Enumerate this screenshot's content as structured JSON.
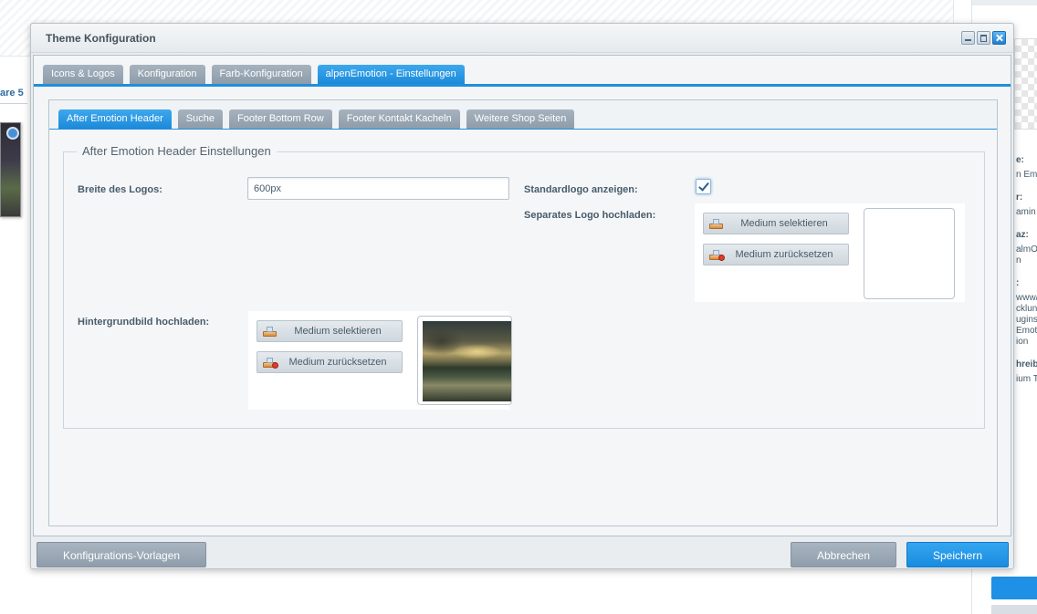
{
  "background": {
    "left_tab_label": "are 5",
    "right_panel_texts": [
      {
        "text": "e:",
        "bold": true
      },
      {
        "text": "n Emo",
        "bold": false
      },
      {
        "text": "r:",
        "bold": true
      },
      {
        "text": "amin I",
        "bold": false
      },
      {
        "text": "az:",
        "bold": true
      },
      {
        "text": "almO",
        "bold": false
      },
      {
        "text": "n",
        "bold": false
      },
      {
        "text": ":",
        "bold": true
      },
      {
        "text": "www/",
        "bold": false
      },
      {
        "text": "cklun",
        "bold": false
      },
      {
        "text": "ugins/",
        "bold": false
      },
      {
        "text": "Emoti",
        "bold": false
      },
      {
        "text": "ion",
        "bold": false
      },
      {
        "text": "hreib",
        "bold": true
      },
      {
        "text": "ium T",
        "bold": false
      }
    ]
  },
  "window": {
    "title": "Theme Konfiguration",
    "outer_tabs": [
      {
        "label": "Icons & Logos",
        "active": false
      },
      {
        "label": "Konfiguration",
        "active": false
      },
      {
        "label": "Farb-Konfiguration",
        "active": false
      },
      {
        "label": "alpenEmotion - Einstellungen",
        "active": true
      }
    ],
    "inner_tabs": [
      {
        "label": "After Emotion Header",
        "active": true
      },
      {
        "label": "Suche",
        "active": false
      },
      {
        "label": "Footer Bottom Row",
        "active": false
      },
      {
        "label": "Footer Kontakt Kacheln",
        "active": false
      },
      {
        "label": "Weitere Shop Seiten",
        "active": false
      }
    ],
    "fieldset": {
      "legend": "After Emotion Header Einstellungen",
      "logo_width_label": "Breite des Logos:",
      "logo_width_value": "600px",
      "standard_logo_label": "Standardlogo anzeigen:",
      "standard_logo_checked": true,
      "separate_logo_label": "Separates Logo hochladen:",
      "background_image_label": "Hintergrundbild hochladen:",
      "select_media_label": "Medium selektieren",
      "reset_media_label": "Medium zurücksetzen"
    },
    "footer": {
      "templates_label": "Konfigurations-Vorlagen",
      "cancel_label": "Abbrechen",
      "save_label": "Speichern"
    }
  },
  "colors": {
    "accent": "#1f8fdc",
    "tab_inactive": "#98a6b3",
    "text": "#475c6a"
  }
}
